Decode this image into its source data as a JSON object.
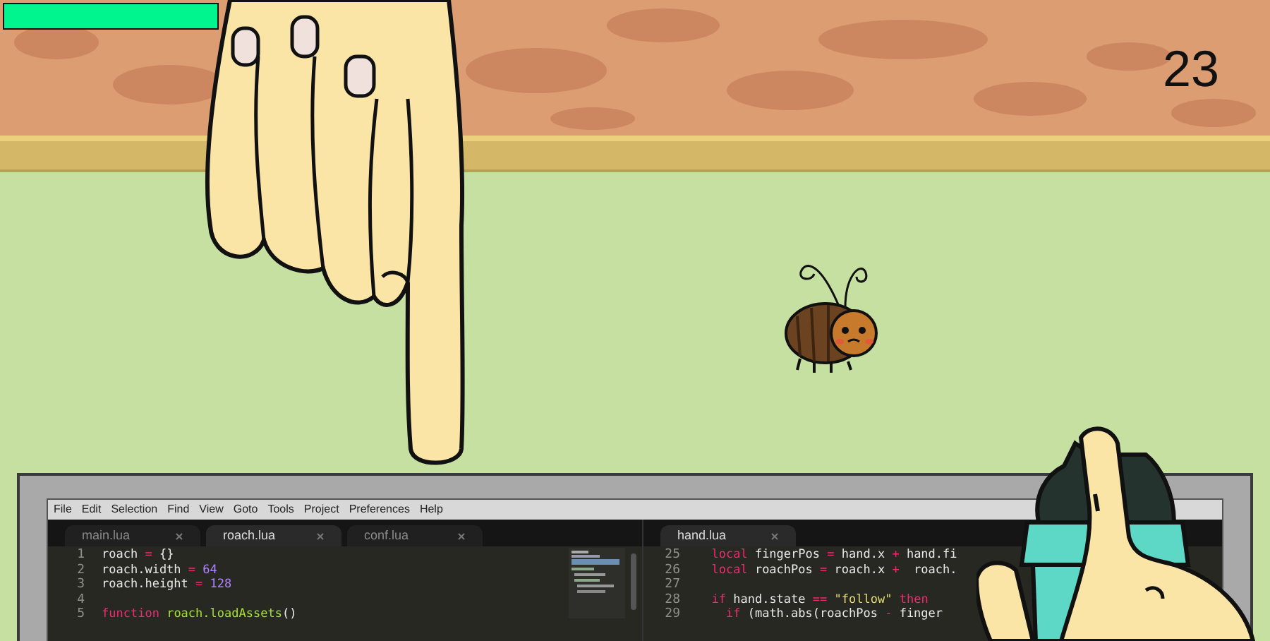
{
  "hud": {
    "health": {
      "level": 1
    },
    "score": "23"
  },
  "editor": {
    "menu": [
      "File",
      "Edit",
      "Selection",
      "Find",
      "View",
      "Goto",
      "Tools",
      "Project",
      "Preferences",
      "Help"
    ],
    "panes": [
      {
        "tabs": [
          {
            "label": "main.lua",
            "selected": false
          },
          {
            "label": "roach.lua",
            "selected": true
          },
          {
            "label": "conf.lua",
            "selected": false
          }
        ],
        "lines": [
          {
            "number": "1",
            "tokens": [
              {
                "text": "roach ",
                "kind": "plain"
              },
              {
                "text": "=",
                "kind": "keyword"
              },
              {
                "text": " {}",
                "kind": "plain"
              }
            ]
          },
          {
            "number": "2",
            "tokens": [
              {
                "text": "roach.width ",
                "kind": "plain"
              },
              {
                "text": "=",
                "kind": "keyword"
              },
              {
                "text": " 64",
                "kind": "number"
              }
            ]
          },
          {
            "number": "3",
            "tokens": [
              {
                "text": "roach.height ",
                "kind": "plain"
              },
              {
                "text": "=",
                "kind": "keyword"
              },
              {
                "text": " 128",
                "kind": "number"
              }
            ]
          },
          {
            "number": "4"
          },
          {
            "number": "5",
            "tokens": [
              {
                "text": "function",
                "kind": "keyword"
              },
              {
                "text": " roach.loadAssets",
                "kind": "function"
              },
              {
                "text": "()",
                "kind": "plain"
              }
            ]
          }
        ],
        "minimap": true
      },
      {
        "tabs": [
          {
            "label": "hand.lua",
            "selected": true
          }
        ],
        "lines": [
          {
            "number": "25",
            "tokens": [
              {
                "text": "  local",
                "kind": "keyword"
              },
              {
                "text": " fingerPos ",
                "kind": "plain"
              },
              {
                "text": "=",
                "kind": "keyword"
              },
              {
                "text": " hand.x ",
                "kind": "plain"
              },
              {
                "text": "+",
                "kind": "keyword"
              },
              {
                "text": " hand.fi",
                "kind": "plain"
              }
            ]
          },
          {
            "number": "26",
            "tokens": [
              {
                "text": "  local",
                "kind": "keyword"
              },
              {
                "text": " roachPos ",
                "kind": "plain"
              },
              {
                "text": "=",
                "kind": "keyword"
              },
              {
                "text": " roach.x ",
                "kind": "plain"
              },
              {
                "text": "+",
                "kind": "keyword"
              },
              {
                "text": "  roach.",
                "kind": "plain"
              }
            ]
          },
          {
            "number": "27"
          },
          {
            "number": "28",
            "tokens": [
              {
                "text": "  if",
                "kind": "keyword"
              },
              {
                "text": " hand.state ",
                "kind": "plain"
              },
              {
                "text": "==",
                "kind": "keyword"
              },
              {
                "text": " \"follow\"",
                "kind": "string"
              },
              {
                "text": " then",
                "kind": "keyword"
              }
            ]
          },
          {
            "number": "29",
            "tokens": [
              {
                "text": "    if",
                "kind": "keyword"
              },
              {
                "text": " (math.abs(roachPos ",
                "kind": "plain"
              },
              {
                "text": "-",
                "kind": "keyword"
              },
              {
                "text": " finger",
                "kind": "plain"
              }
            ]
          }
        ]
      }
    ]
  }
}
